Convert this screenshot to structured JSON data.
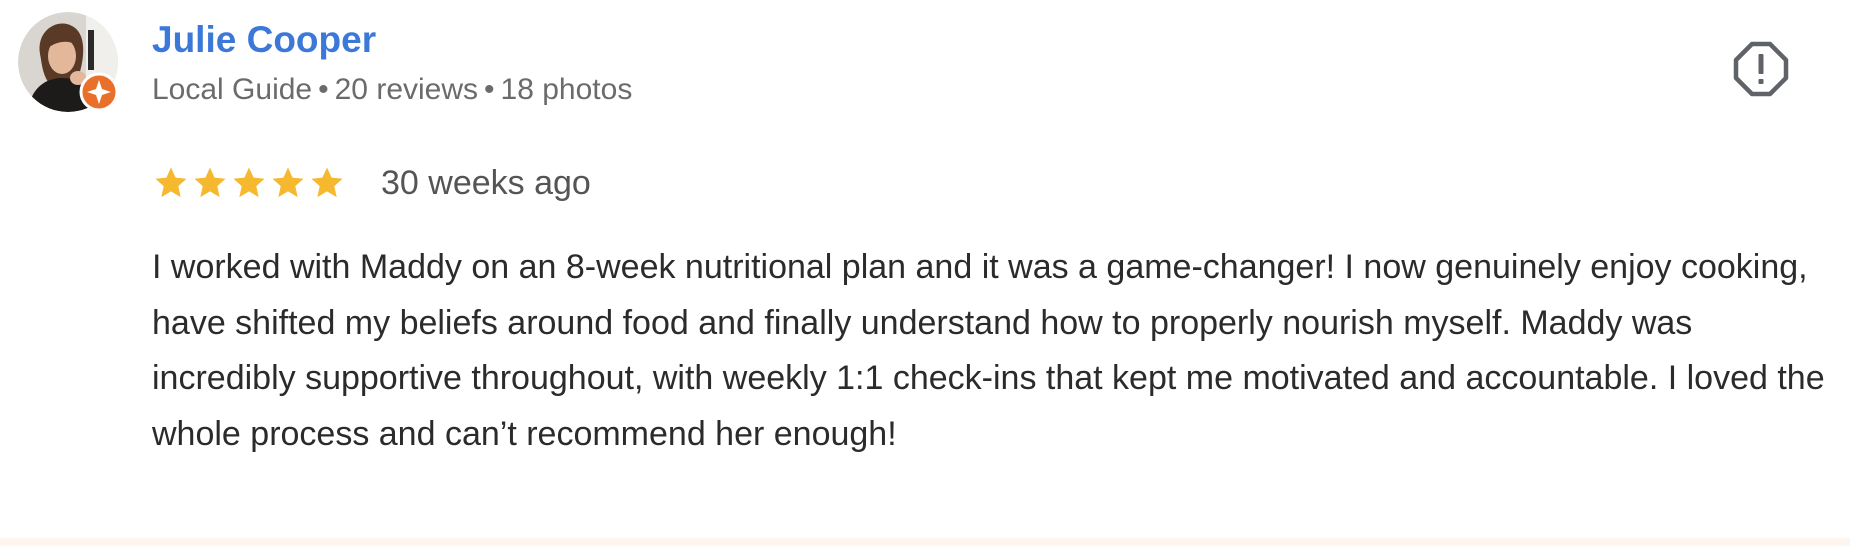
{
  "review": {
    "author": {
      "name": "Julie Cooper",
      "role": "Local Guide",
      "reviews": "20 reviews",
      "photos": "18 photos",
      "separator": "•",
      "badge_icon": "local-guide-star-badge-icon"
    },
    "rating": {
      "value": 5,
      "max": 5,
      "star_color": "#f5b82e"
    },
    "date": "30 weeks ago",
    "text": "I worked with Maddy on an 8-week nutritional plan and it was a game-changer! I now genuinely enjoy cooking, have shifted my beliefs around food and finally understand how to properly nourish myself. Maddy was incredibly supportive throughout, with weekly 1:1 check-ins that kept me motivated and accountable. I loved the whole process and can’t recommend her enough!",
    "actions": {
      "report_icon": "report-flag-icon"
    }
  },
  "colors": {
    "name": "#3b78d8",
    "meta": "#6b6b6b",
    "text": "#2b2b2b",
    "badge": "#e8702a"
  }
}
